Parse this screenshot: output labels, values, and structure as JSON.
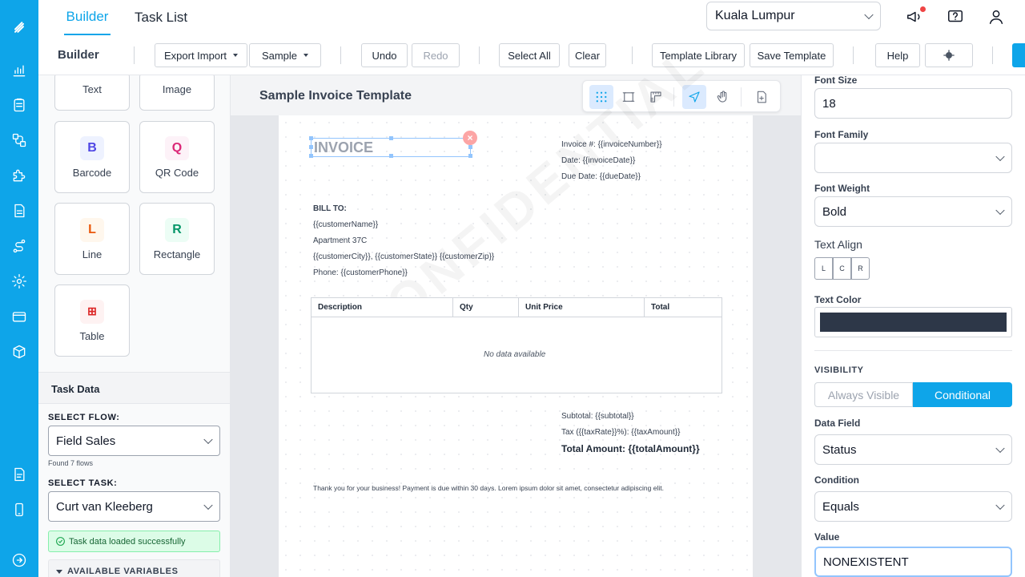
{
  "header": {
    "tabs": [
      {
        "label": "Builder"
      },
      {
        "label": "Task List"
      }
    ],
    "city": "Kuala Lumpur"
  },
  "toolbar": {
    "title": "Builder",
    "export_import": "Export Import",
    "sample": "Sample",
    "undo": "Undo",
    "redo": "Redo",
    "select_all": "Select All",
    "clear": "Clear",
    "template_library": "Template Library",
    "save_template": "Save Template",
    "help": "Help"
  },
  "components": [
    {
      "label": "Text",
      "letter": ""
    },
    {
      "label": "Image",
      "letter": ""
    },
    {
      "label": "Barcode",
      "letter": "B",
      "color": "#4f46e5",
      "bg": "#eef2ff"
    },
    {
      "label": "QR Code",
      "letter": "Q",
      "color": "#db2777",
      "bg": "#fdf2f8"
    },
    {
      "label": "Line",
      "letter": "L",
      "color": "#ea580c",
      "bg": "#fff7ed"
    },
    {
      "label": "Rectangle",
      "letter": "R",
      "color": "#059669",
      "bg": "#ecfdf5"
    },
    {
      "label": "Table",
      "letter": "⊞",
      "color": "#dc2626",
      "bg": "#fef2f2"
    }
  ],
  "task_data": {
    "title": "Task Data",
    "select_flow_label": "SELECT FLOW:",
    "flow_value": "Field Sales",
    "flows_found": "Found 7 flows",
    "select_task_label": "SELECT TASK:",
    "task_value": "Curt van Kleeberg",
    "success_msg": "Task data loaded successfully",
    "available_variables": "AVAILABLE VARIABLES"
  },
  "canvas": {
    "template_name": "Sample Invoice Template",
    "watermark": "CONFIDENTIAL",
    "invoice_title": "INVOICE",
    "invoice_number": "Invoice #: {{invoiceNumber}}",
    "date": "Date: {{invoiceDate}}",
    "due_date": "Due Date: {{dueDate}}",
    "bill_to": "BILL TO:",
    "customer_name": "{{customerName}}",
    "address": "Apartment 37C",
    "city_line": "{{customerCity}}, {{customerState}} {{customerZip}}",
    "phone": "Phone: {{customerPhone}}",
    "table_headers": [
      "Description",
      "Qty",
      "Unit Price",
      "Total"
    ],
    "no_data": "No data available",
    "subtotal": "Subtotal: {{subtotal}}",
    "tax": "Tax ({{taxRate}}%): {{taxAmount}}",
    "total": "Total Amount: {{totalAmount}}",
    "footer": "Thank you for your business! Payment is due within 30 days. Lorem ipsum dolor sit amet, consectetur adipiscing elit."
  },
  "properties": {
    "font_size_label": "Font Size",
    "font_size": "18",
    "font_family_label": "Font Family",
    "font_family": "",
    "font_weight_label": "Font Weight",
    "font_weight": "Bold",
    "text_align_label": "Text Align",
    "align_options": [
      "L",
      "C",
      "R"
    ],
    "text_color_label": "Text Color",
    "text_color": "#2d3748",
    "visibility_label": "VISIBILITY",
    "always_visible": "Always Visible",
    "conditional": "Conditional",
    "data_field_label": "Data Field",
    "data_field": "Status",
    "condition_label": "Condition",
    "condition": "Equals",
    "value_label": "Value",
    "value": "NONEXISTENT"
  }
}
